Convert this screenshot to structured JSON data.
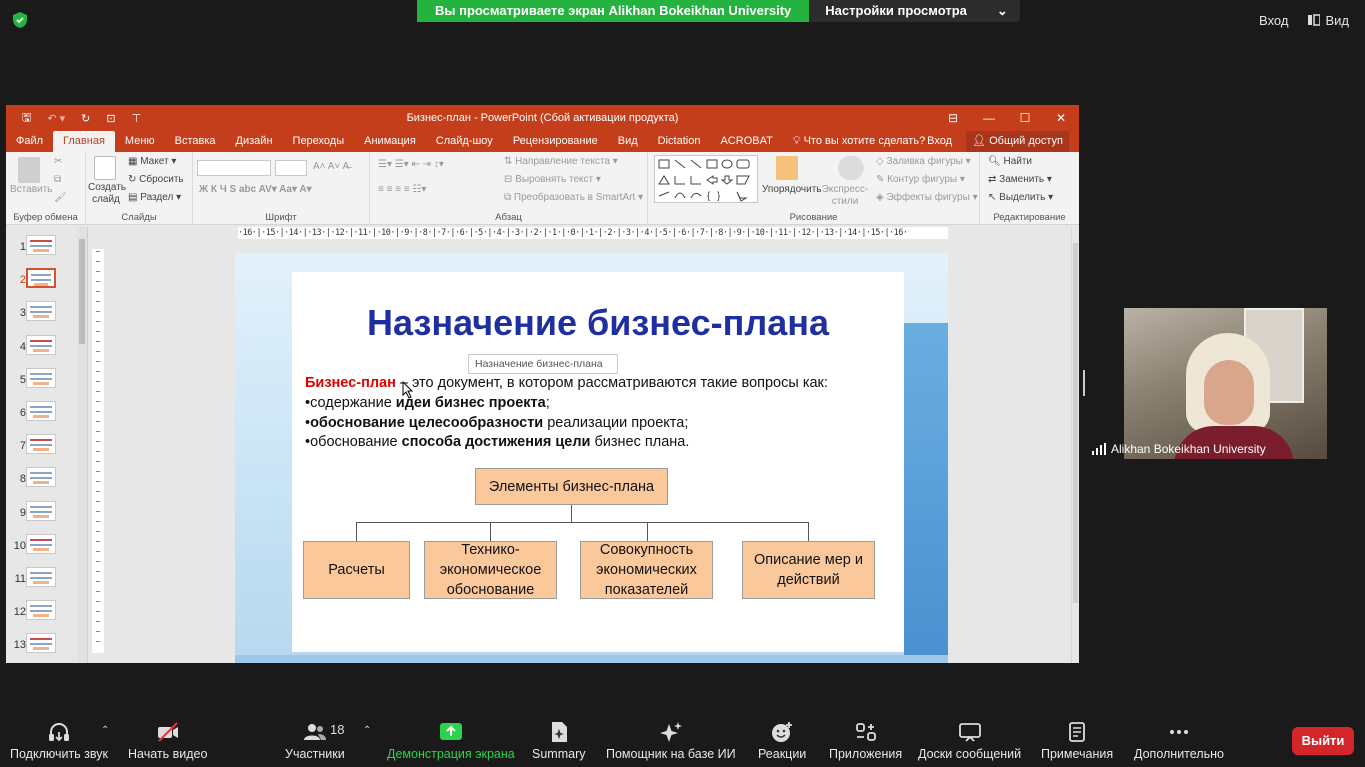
{
  "zoom": {
    "banner_text": "Вы просматриваете экран Alikhan Bokeikhan University",
    "view_options_label": "Настройки просмотра",
    "sign_in_label": "Вход",
    "view_label": "Вид",
    "participant_name": "Alikhan Bokeikhan University",
    "participants_count": "18",
    "toolbar": {
      "audio": "Подключить звук",
      "video": "Начать видео",
      "participants": "Участники",
      "share": "Демонстрация экрана",
      "summary": "Summary",
      "assistant": "Помощник на базе ИИ",
      "reactions": "Реакции",
      "apps": "Приложения",
      "whiteboards": "Доски сообщений",
      "notes": "Примечания",
      "more": "Дополнительно",
      "leave": "Выйти"
    }
  },
  "ppt": {
    "window_title": "Бизнес-план  -  PowerPoint (Сбой активации продукта)",
    "tabs": [
      "Файл",
      "Главная",
      "Меню",
      "Вставка",
      "Дизайн",
      "Переходы",
      "Анимация",
      "Слайд-шоу",
      "Рецензирование",
      "Вид",
      "Dictation",
      "ACROBAT"
    ],
    "tell_me": "Что вы хотите сделать?",
    "sign_in": "Вход",
    "share": "Общий доступ",
    "ribbon": {
      "clipboard_group": "Буфер обмена",
      "paste": "Вставить",
      "slides_group": "Слайды",
      "new_slide": "Создать слайд",
      "layout": "Макет",
      "reset": "Сбросить",
      "section": "Раздел",
      "font_group": "Шрифт",
      "paragraph_group": "Абзац",
      "text_direction": "Направление текста",
      "align_text": "Выровнять текст",
      "smartart": "Преобразовать в SmartArt",
      "drawing_group": "Рисование",
      "arrange": "Упорядочить",
      "quick_styles": "Экспресс-стили",
      "shape_fill": "Заливка фигуры",
      "shape_outline": "Контур фигуры",
      "shape_effects": "Эффекты фигуры",
      "editing_group": "Редактирование",
      "find": "Найти",
      "replace": "Заменить",
      "select": "Выделить"
    },
    "slide_numbers": [
      "1",
      "2",
      "3",
      "4",
      "5",
      "6",
      "7",
      "8",
      "9",
      "10",
      "11",
      "12",
      "13"
    ],
    "active_slide": "2",
    "ruler_text": "·16·|·15·|·14·|·13·|·12·|·11·|·10·|·9·|·8·|·7·|·6·|·5·|·4·|·3·|·2·|·1·|·0·|·1·|·2·|·3·|·4·|·5·|·6·|·7·|·8·|·9·|·10·|·11·|·12·|·13·|·14·|·15·|·16·"
  },
  "slide": {
    "title": "Назначение бизнес-плана",
    "tooltip": "Назначение бизнес-плана",
    "line1_term": "Бизнес-план",
    "line1_rest": " – это документ, в котором рассматриваются такие вопросы как:",
    "line2_a": "•содержание ",
    "line2_b": "идеи бизнес проекта",
    "line2_c": ";",
    "line3_a": "•",
    "line3_b": "обоснование целесообразности",
    "line3_c": " реализации проекта;",
    "line4_a": "•обоснование ",
    "line4_b": "способа достижения цели",
    "line4_c": " бизнес плана.",
    "root_box": "Элементы бизнес-плана",
    "child_1": "Расчеты",
    "child_2": "Технико-экономическое обоснование",
    "child_3": "Совокупность экономических показателей",
    "child_4": "Описание мер и действий"
  }
}
